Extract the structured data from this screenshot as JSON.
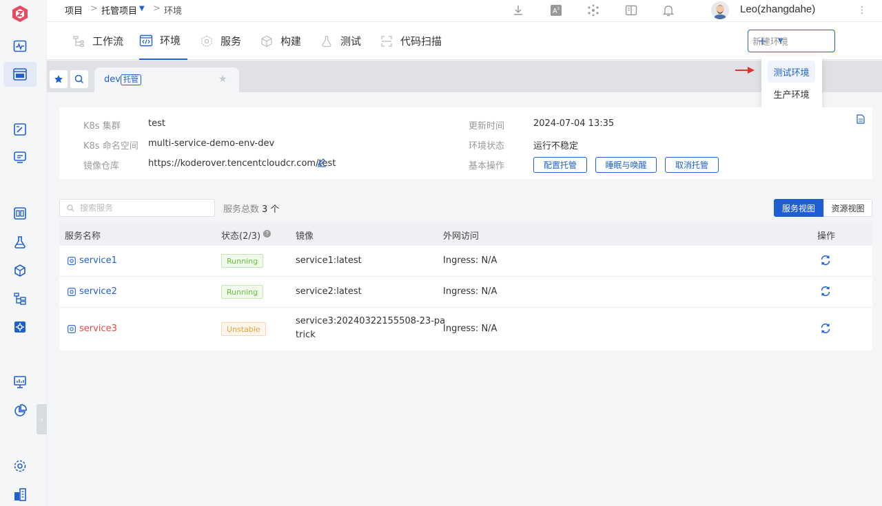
{
  "breadcrumb": {
    "root": "项目",
    "sep": ">",
    "project": "托管项目",
    "current": "环境"
  },
  "user": {
    "name": "Leo(zhangdahe)"
  },
  "tabs": [
    {
      "label": "工作流",
      "icon": "workflow-icon"
    },
    {
      "label": "环境",
      "icon": "code-env-icon"
    },
    {
      "label": "服务",
      "icon": "service-icon"
    },
    {
      "label": "构建",
      "icon": "build-icon"
    },
    {
      "label": "测试",
      "icon": "test-icon"
    },
    {
      "label": "代码扫描",
      "icon": "scan-icon"
    }
  ],
  "new_env": {
    "label": "新建环境",
    "plus": "+",
    "caret": "▼"
  },
  "dropdown": {
    "items": [
      "测试环境",
      "生产环境"
    ]
  },
  "env_tab": {
    "name": "dev",
    "tag": "托管"
  },
  "info": {
    "cluster_label": "K8s 集群",
    "cluster": "test",
    "namespace_label": "K8s 命名空间",
    "namespace": "multi-service-demo-env-dev",
    "registry_label": "镜像仓库",
    "registry": "https://koderover.tencentcloudcr.com/test",
    "updated_label": "更新时间",
    "updated": "2024-07-04 13:35",
    "status_label": "环境状态",
    "status": "运行不稳定",
    "ops_label": "基本操作",
    "ops": [
      "配置托管",
      "睡眠与唤醒",
      "取消托管"
    ]
  },
  "search": {
    "placeholder": "搜索服务"
  },
  "count": {
    "label": "服务总数",
    "value": "3 个"
  },
  "views": {
    "service": "服务视图",
    "resource": "资源视图"
  },
  "table": {
    "headers": {
      "name": "服务名称",
      "status": "状态(2/3)",
      "image": "镜像",
      "access": "外网访问",
      "ops": "操作"
    },
    "rows": [
      {
        "name": "service1",
        "status": "Running",
        "image": "service1:latest",
        "access": "Ingress: N/A"
      },
      {
        "name": "service2",
        "status": "Running",
        "image": "service2:latest",
        "access": "Ingress: N/A"
      },
      {
        "name": "service3",
        "status": "Unstable",
        "image_line1": "service3:20240322155508-23-pa",
        "image_line2": "trick",
        "access": "Ingress: N/A"
      }
    ]
  },
  "colors": {
    "accent": "#1f5fd1",
    "brand": "#e84a5f",
    "running": "#67c23a",
    "unstable": "#e6a23c",
    "error": "#e04a3f"
  }
}
